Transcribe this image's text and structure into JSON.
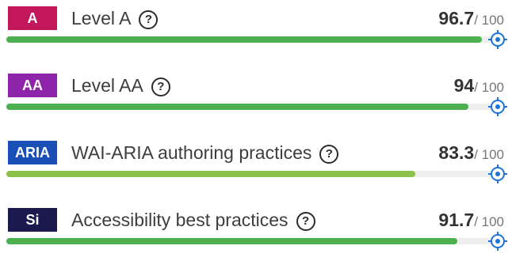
{
  "rows": [
    {
      "badge": "A",
      "badge_color": "#c2185b",
      "label": "Level A",
      "score": "96.7",
      "max": "/ 100",
      "progress": 0.967,
      "bar_color": "#4caf50"
    },
    {
      "badge": "AA",
      "badge_color": "#8e24aa",
      "label": "Level AA",
      "score": "94",
      "max": "/ 100",
      "progress": 0.94,
      "bar_color": "#4caf50"
    },
    {
      "badge": "ARIA",
      "badge_color": "#1a4fb8",
      "label": "WAI-ARIA authoring practices",
      "score": "83.3",
      "max": "/ 100",
      "progress": 0.833,
      "bar_color": "#8bc34a"
    },
    {
      "badge": "Si",
      "badge_color": "#1a1a4e",
      "label": "Accessibility best practices",
      "score": "91.7",
      "max": "/ 100",
      "progress": 0.917,
      "bar_color": "#4caf50"
    }
  ],
  "help_icon": "question-circle-icon",
  "target_icon": "crosshair-target-icon",
  "target_color": "#1e73d6"
}
